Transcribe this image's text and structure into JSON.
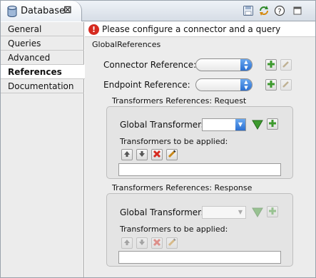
{
  "tab": {
    "title": "Database",
    "close_glyph": "⊠",
    "icon": "database-icon"
  },
  "toolbar": {
    "icons": [
      "save-icon",
      "refresh-icon",
      "help-icon",
      "maximize-icon"
    ]
  },
  "nav": {
    "items": [
      {
        "label": "General",
        "active": false
      },
      {
        "label": "Queries",
        "active": false
      },
      {
        "label": "Advanced",
        "active": false
      },
      {
        "label": "References",
        "active": true
      },
      {
        "label": "Documentation",
        "active": false
      }
    ]
  },
  "message": {
    "icon": "error-icon",
    "glyph": "!",
    "text": "Please configure a connector and a query"
  },
  "global_refs": {
    "section_title": "GlobalReferences",
    "connector_label": "Connector Reference:",
    "endpoint_label": "Endpoint Reference:",
    "connector_value": "",
    "endpoint_value": ""
  },
  "request": {
    "title": "Transformers References: Request",
    "global_label": "Global Transformers:",
    "applied_label": "Transformers to be applied:",
    "global_value": "",
    "applied_value": ""
  },
  "response": {
    "title": "Transformers References: Response",
    "global_label": "Global Transformers:",
    "applied_label": "Transformers to be applied:",
    "global_value": "",
    "applied_value": ""
  },
  "colors": {
    "add_green": "#3d9a2e",
    "delete_red": "#d62a1f",
    "arrow_blue": "#2a6fd1",
    "error_red": "#d62a1f"
  }
}
